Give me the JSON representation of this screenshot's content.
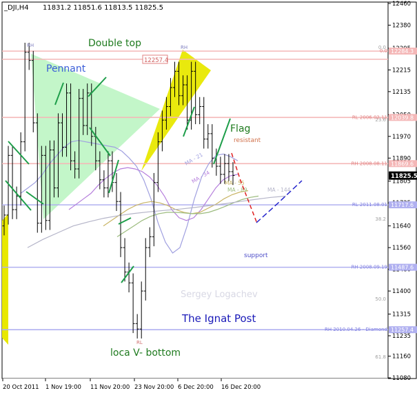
{
  "header": {
    "symbol": "_DJI,H4",
    "ohlc": "11831.2 11851.6 11813.5 11825.5"
  },
  "chart_data": {
    "type": "candlestick",
    "symbol": "_DJI",
    "timeframe": "H4",
    "ylim": [
      11080,
      12460
    ],
    "y_ticks": [
      12460,
      12380,
      12295,
      12215,
      12135,
      12050,
      11970,
      11890,
      11805,
      11725,
      11640,
      11560,
      11480,
      11400,
      11315,
      11235,
      11160,
      11080
    ],
    "x_ticks": [
      "20 Oct 2011",
      "1 Nov 19:00",
      "11 Nov 20:00",
      "23 Nov 20:00",
      "6 Dec 20:00",
      "16 Dec 20:00"
    ],
    "current_price": "11825.5",
    "series_close": [
      11680,
      11900,
      11700,
      11750,
      11950,
      12280,
      12250,
      12020,
      11650,
      11900,
      11660,
      11920,
      11780,
      12020,
      11930,
      12130,
      11880,
      11850,
      12110,
      12010,
      12130,
      11970,
      11880,
      11810,
      11780,
      11880,
      11800,
      11730,
      11560,
      11470,
      11430,
      11280,
      11260,
      11400,
      11560,
      11600,
      11800,
      11950,
      12030,
      12080,
      12150,
      12210,
      12120,
      12160,
      12030,
      12210,
      12050,
      12080,
      11960,
      11980,
      11890,
      11860,
      11830,
      11870,
      11840,
      11826
    ],
    "moving_averages": [
      {
        "name": "MA - 21",
        "color": "#a0a0e0",
        "values": [
          11760,
          11780,
          11800,
          11830,
          11870,
          11900,
          11930,
          11950,
          11955,
          11950,
          11945,
          11940,
          11935,
          11930,
          11915,
          11890,
          11860,
          11810,
          11740,
          11650,
          11580,
          11540,
          11560,
          11640,
          11740,
          11820,
          11870,
          11900,
          11905,
          11895,
          11880
        ]
      },
      {
        "name": "MA - 34",
        "color": "#b57edc",
        "values": [
          11700,
          11720,
          11740,
          11760,
          11790,
          11815,
          11835,
          11850,
          11855,
          11850,
          11840,
          11820,
          11790,
          11750,
          11700,
          11670,
          11660,
          11670,
          11700,
          11740,
          11780,
          11810,
          11825,
          11830
        ]
      },
      {
        "name": "MA - 55",
        "color": "#c8b464",
        "values": [
          11640,
          11660,
          11680,
          11700,
          11715,
          11725,
          11730,
          11725,
          11715,
          11700,
          11690,
          11685,
          11690,
          11705,
          11720,
          11740,
          11755,
          11765,
          11770
        ]
      },
      {
        "name": "MA - 89",
        "color": "#9bbb7d",
        "values": [
          11600,
          11620,
          11640,
          11660,
          11675,
          11685,
          11690,
          11690,
          11688,
          11685,
          11685,
          11690,
          11700,
          11712,
          11725,
          11737,
          11745,
          11750
        ]
      },
      {
        "name": "MA - 144",
        "color": "#b4b4c8",
        "values": [
          11560,
          11590,
          11615,
          11640,
          11655,
          11668,
          11678,
          11686,
          11692,
          11697,
          11702,
          11708,
          11715,
          11722,
          11730,
          11738,
          11745,
          11750
        ]
      }
    ],
    "levels": [
      {
        "label": "0.0",
        "price": "12284.3",
        "color": "#f4b7b7"
      },
      {
        "label": "RL 2006.02.11",
        "price": "12039.8",
        "color": "#f4b7b7"
      },
      {
        "label": "RH 2008.08.11",
        "price": "11869.6",
        "color": "#f4b7b7"
      },
      {
        "label": "RL 2011.08.01",
        "price": "11717.6",
        "color": "#b0b0f0"
      },
      {
        "label": "RH 2008.09.19",
        "price": "11487.6",
        "color": "#b0b0f0"
      },
      {
        "label": "RH 2010.04.26 - Diamond",
        "price": "11257.4",
        "color": "#b0b0f0"
      }
    ],
    "fib_labels": [
      "0.0",
      "23.6",
      "38.2",
      "50.0",
      "61.8"
    ],
    "annotations": {
      "double_top": "Double top",
      "pennant": "Pennant",
      "flag": "Flag",
      "resistant": "resistant",
      "support": "support",
      "v_bottom": "loca V- bottom",
      "watermark": "Sergey Logachev",
      "site": "The Ignat Post",
      "price_box": "12257.4",
      "rh1": "RH",
      "rh2": "RH",
      "rl": "RL"
    }
  }
}
